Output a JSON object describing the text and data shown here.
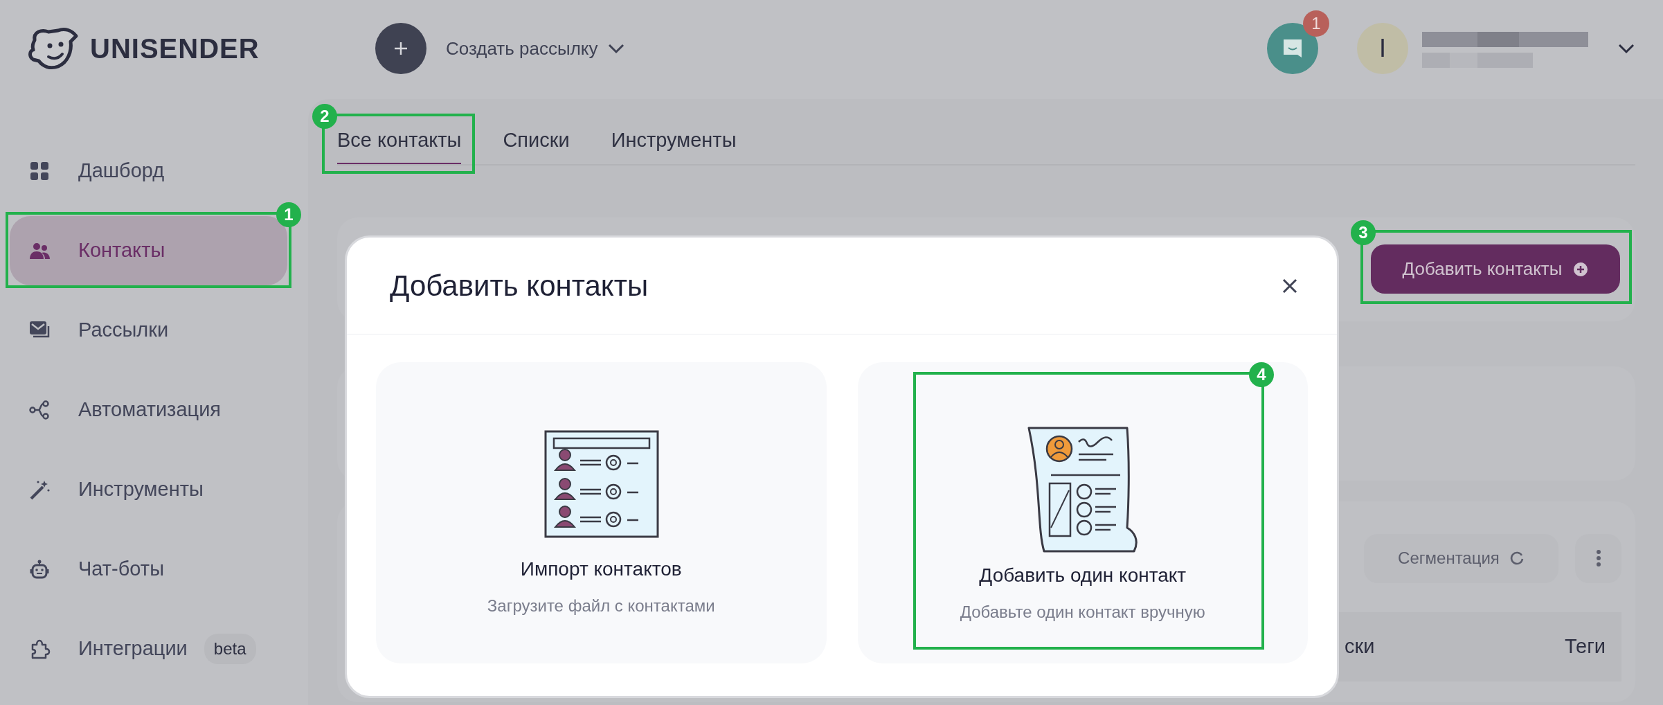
{
  "header": {
    "logo_text": "UNISENDER",
    "create_label": "Создать рассылку",
    "chat_badge": "1",
    "avatar_initial": "I"
  },
  "sidebar": {
    "items": [
      {
        "label": "Дашборд",
        "selected": false
      },
      {
        "label": "Контакты",
        "selected": true,
        "callout": "1"
      },
      {
        "label": "Рассылки",
        "selected": false
      },
      {
        "label": "Автоматизация",
        "selected": false
      },
      {
        "label": "Инструменты",
        "selected": false
      },
      {
        "label": "Чат-боты",
        "selected": false
      },
      {
        "label": "Интеграции",
        "selected": false,
        "badge": "beta"
      }
    ]
  },
  "tabs": [
    {
      "label": "Все контакты",
      "selected": true,
      "callout": "2"
    },
    {
      "label": "Списки",
      "selected": false
    },
    {
      "label": "Инструменты",
      "selected": false
    }
  ],
  "add_button": {
    "label": "Добавить контакты",
    "callout": "3"
  },
  "segmentation_button": {
    "label": "Сегментация"
  },
  "table": {
    "columns": [
      "ски",
      "Теги"
    ]
  },
  "modal": {
    "title": "Добавить контакты",
    "options": [
      {
        "kind": "import",
        "title": "Импорт контактов",
        "subtitle": "Загрузите файл с контактами"
      },
      {
        "kind": "single",
        "title": "Добавить один контакт",
        "subtitle": "Добавьте один контакт вручную",
        "callout": "4"
      }
    ]
  }
}
